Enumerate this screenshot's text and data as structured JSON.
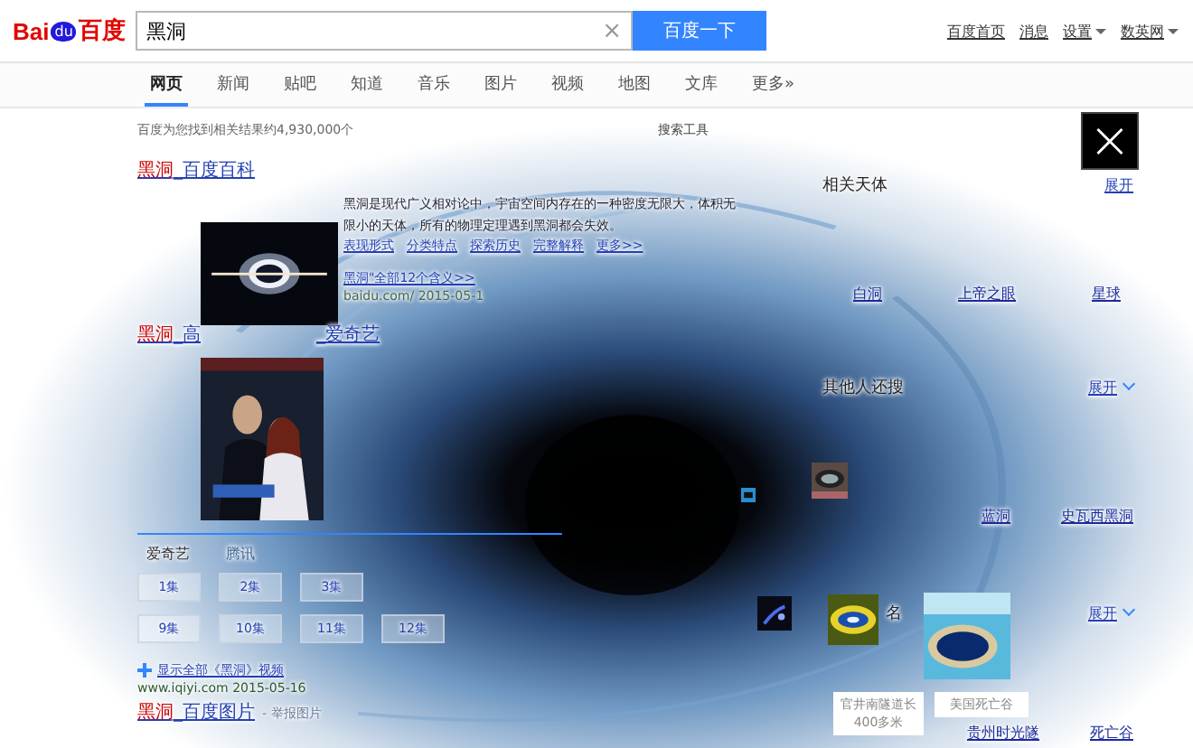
{
  "header": {
    "logo": {
      "left": "Bai",
      "paw": "du",
      "right": "百度"
    },
    "search": {
      "value": "黑洞",
      "clear": "×"
    },
    "button": "百度一下",
    "links": [
      {
        "label": "百度首页",
        "dropdown": false
      },
      {
        "label": "消息",
        "dropdown": false
      },
      {
        "label": "设置",
        "dropdown": true
      },
      {
        "label": "数英网",
        "dropdown": true
      }
    ]
  },
  "tabs": [
    {
      "label": "网页",
      "selected": true
    },
    {
      "label": "新闻",
      "selected": false
    },
    {
      "label": "贴吧",
      "selected": false
    },
    {
      "label": "知道",
      "selected": false
    },
    {
      "label": "音乐",
      "selected": false
    },
    {
      "label": "图片",
      "selected": false
    },
    {
      "label": "视频",
      "selected": false
    },
    {
      "label": "地图",
      "selected": false
    },
    {
      "label": "文库",
      "selected": false
    },
    {
      "label": "更多»",
      "selected": false
    }
  ],
  "stats": "百度为您找到相关结果约4,930,000个",
  "tools": "搜索工具",
  "results": [
    {
      "kind": "baike",
      "highlight": "黑洞",
      "title": "_百度百科",
      "snippet": "黑洞是现代广义相对论中，宇宙空间内存在的一种密度无限大，体积无限小的天体，所有的物理定理遇到黑洞都会失效。",
      "links": [
        "表现形式",
        "分类特点",
        "探索历史",
        "完整解释",
        "更多>>"
      ],
      "more": "黑洞\"全部12个含义>>",
      "url": "baidu.com/ 2015-05-1"
    },
    {
      "kind": "video",
      "highlight": "黑洞",
      "title": "_高",
      "title_tail": "_爱奇艺",
      "sources": [
        {
          "label": "爱奇艺",
          "selected": true
        },
        {
          "label": "腾讯",
          "selected": false
        }
      ],
      "episodes": [
        "1集",
        "2集",
        "3集",
        "9集",
        "10集",
        "11集",
        "12集"
      ],
      "show_all": "显示全部《黑洞》视频",
      "url": "www.iqiyi.com 2015-05-16"
    },
    {
      "highlight": "黑洞",
      "title": "_百度图片",
      "note": "- 举报图片"
    }
  ],
  "sidebar": {
    "close": "×",
    "sections": [
      {
        "title": "相关天体",
        "toggle": "展开",
        "items": [
          "白洞",
          "上帝之眼",
          "星球"
        ]
      },
      {
        "title": "其他人还搜",
        "toggle": "展开",
        "items": [
          "蓝洞",
          "史瓦西黑洞"
        ]
      },
      {
        "title": "名",
        "toggle": "展开",
        "items": [
          "贵州时光隧",
          "死亡谷"
        ]
      }
    ],
    "tooltips": [
      "官井南隧道长400多米",
      "美国死亡谷"
    ]
  }
}
